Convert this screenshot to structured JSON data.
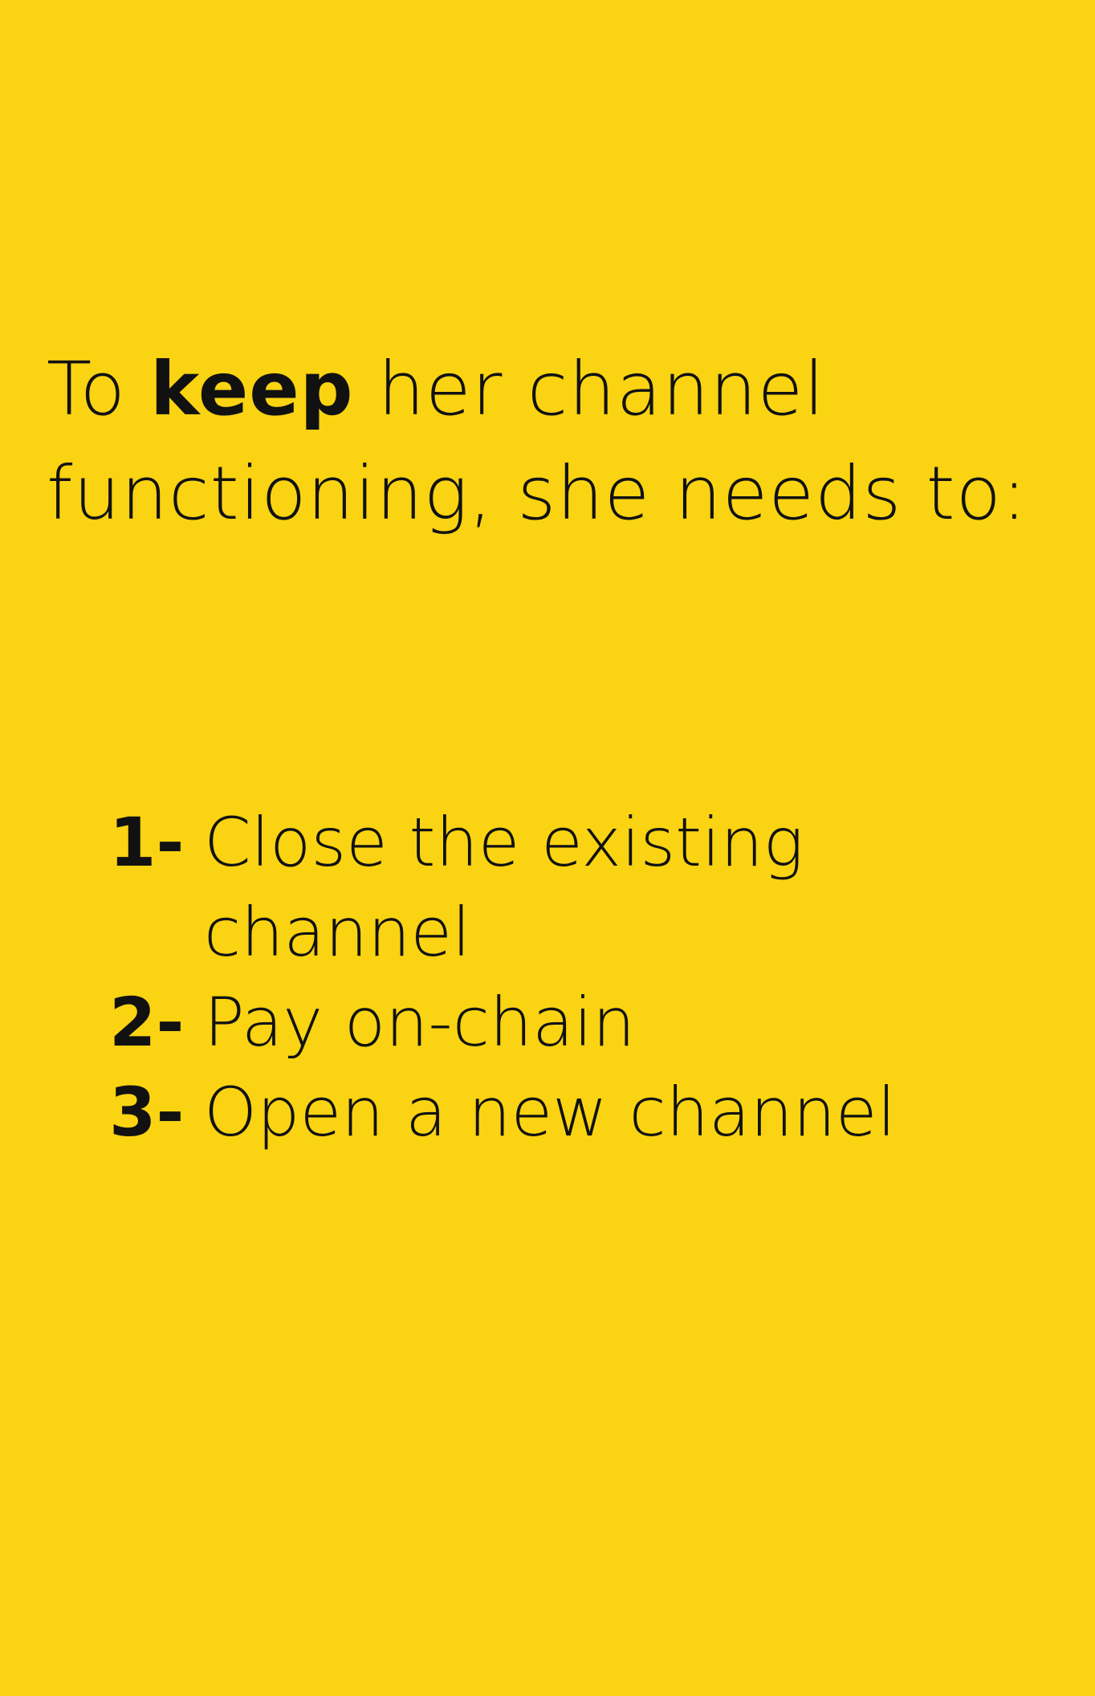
{
  "intro": {
    "before": "To ",
    "keyword": "keep",
    "after": " her channel functioning, she needs to:"
  },
  "steps": [
    {
      "number": "1-",
      "text": "Close the existing channel"
    },
    {
      "number": "2-",
      "text": "Pay on-chain"
    },
    {
      "number": "3-",
      "text": "Open a new channel"
    }
  ],
  "colors": {
    "background": "#fad312",
    "text": "#111111"
  }
}
